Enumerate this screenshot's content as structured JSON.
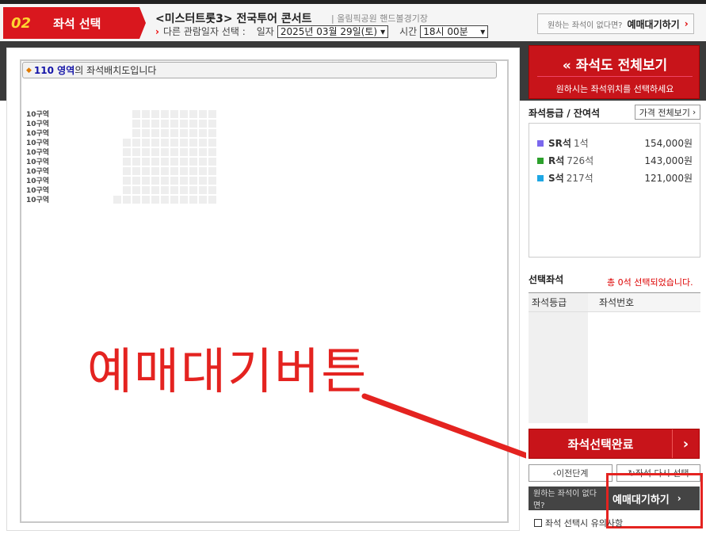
{
  "header": {
    "step_number": "02",
    "step_label": "좌석 선택",
    "show_title": "<미스터트롯3> 전국투어 콘서트",
    "venue": "| 올림픽공원 핸드볼경기장",
    "other_date_label": "다른 관람일자 선택 :",
    "date_label": "일자",
    "date_value": "2025년 03월 29일(토)",
    "time_label": "시간",
    "time_value": "18시 00분",
    "waitlist_small": "원하는 좌석이 없다면?",
    "waitlist_label": "예매대기하기"
  },
  "seatmap": {
    "zone_name": "110 영역",
    "zone_suffix": "의 좌석배치도입니다",
    "row_labels": [
      "10구역",
      "10구역",
      "10구역",
      "10구역",
      "10구역",
      "10구역",
      "10구역",
      "10구역",
      "10구역",
      "10구역"
    ],
    "annotation": "예매대기버튼"
  },
  "sidebar": {
    "full_view_title": "좌석도 전체보기",
    "full_view_subtitle": "원하시는 좌석위치를 선택하세요",
    "grade_heading": "좌석등급 / 잔여석",
    "price_all_button": "가격 전체보기",
    "grades": [
      {
        "name": "SR석",
        "count": "1석",
        "price": "154,000원",
        "color": "#7b68ee"
      },
      {
        "name": "R석",
        "count": "726석",
        "price": "143,000원",
        "color": "#2ca02c"
      },
      {
        "name": "S석",
        "count": "217석",
        "price": "121,000원",
        "color": "#1ea7e4"
      }
    ],
    "selected_heading": "선택좌석",
    "selected_count": "총 0석 선택되었습니다.",
    "col_grade": "좌석등급",
    "col_seat": "좌석번호",
    "complete_button": "좌석선택완료",
    "prev_button": "이전단계",
    "reselect_button": "좌석 다시 선택",
    "waitlist_small": "원하는 좌석이 없다면?",
    "waitlist_button": "예매대기하기",
    "notice": "좌석 선택시 유의사항"
  },
  "colors": {
    "brand_red": "#d9171e",
    "annotation_red": "#e42320"
  }
}
